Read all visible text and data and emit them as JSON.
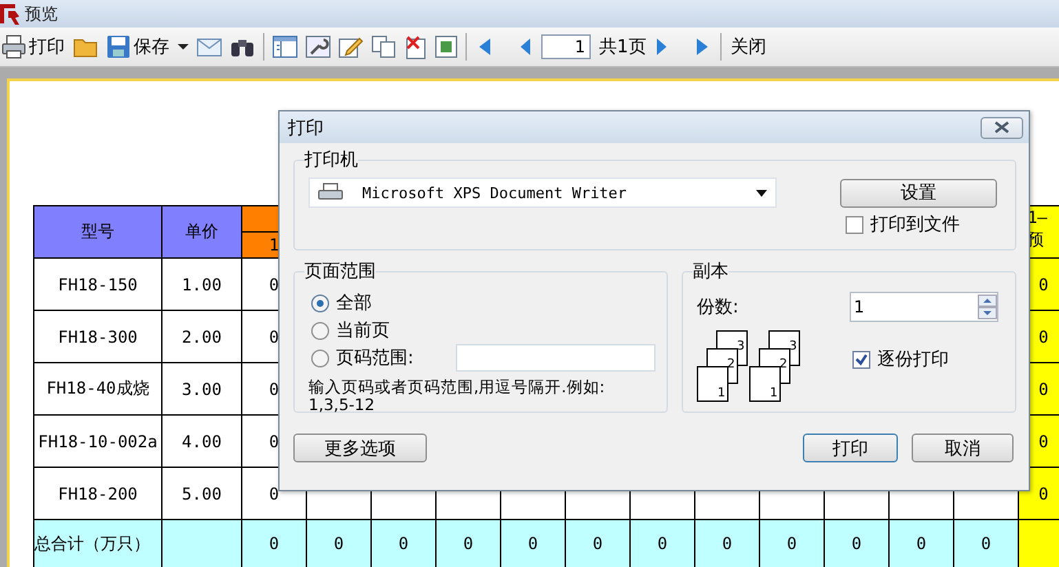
{
  "window": {
    "title": "预览"
  },
  "toolbar": {
    "print": "打印",
    "save": "保存",
    "page": "1",
    "page_count": "共1页",
    "close": "关闭"
  },
  "table": {
    "columns": [
      "型号",
      "单价"
    ],
    "month_header": "1",
    "forecast_header": [
      "1—",
      "预"
    ],
    "rows": [
      {
        "model": "FH18-150",
        "price": "1.00",
        "values": [
          "0"
        ],
        "forecast": "0"
      },
      {
        "model": "FH18-300",
        "price": "2.00",
        "values": [
          "0"
        ],
        "forecast": "0"
      },
      {
        "model": "FH18-40成烧",
        "price": "3.00",
        "values": [
          "0"
        ],
        "forecast": "0"
      },
      {
        "model": "FH18-10-002a",
        "price": "4.00",
        "values": [
          "0"
        ],
        "forecast": "0"
      },
      {
        "model": "FH18-200",
        "price": "5.00",
        "values": [
          "0"
        ],
        "forecast": "0"
      }
    ],
    "total": {
      "label": "总合计（万只）",
      "values": [
        "0",
        "0",
        "0",
        "0",
        "0",
        "0",
        "0",
        "0",
        "0",
        "0",
        "0",
        "0"
      ]
    }
  },
  "dialog": {
    "title": "打印",
    "printer": {
      "label": "打印机",
      "name": "Microsoft XPS Document Writer",
      "setup": "设置",
      "print_to_file": {
        "label": "打印到文件",
        "checked": false
      }
    },
    "page_range": {
      "label": "页面范围",
      "options": [
        {
          "label": "全部",
          "selected": true
        },
        {
          "label": "当前页",
          "selected": false
        },
        {
          "label": "页码范围:",
          "selected": false
        }
      ],
      "hint_lines": [
        "输入页码或者页码范围,用逗号隔开.例如:",
        "1,3,5-12"
      ]
    },
    "copies": {
      "label": "副本",
      "count_label": "份数:",
      "count": "1",
      "stacks": [
        [
          "3",
          "2",
          "1"
        ],
        [
          "3",
          "2",
          "1"
        ]
      ],
      "collate": {
        "label": "逐份打印",
        "checked": true
      }
    },
    "buttons": {
      "more": "更多选项",
      "print": "打印",
      "cancel": "取消"
    }
  }
}
